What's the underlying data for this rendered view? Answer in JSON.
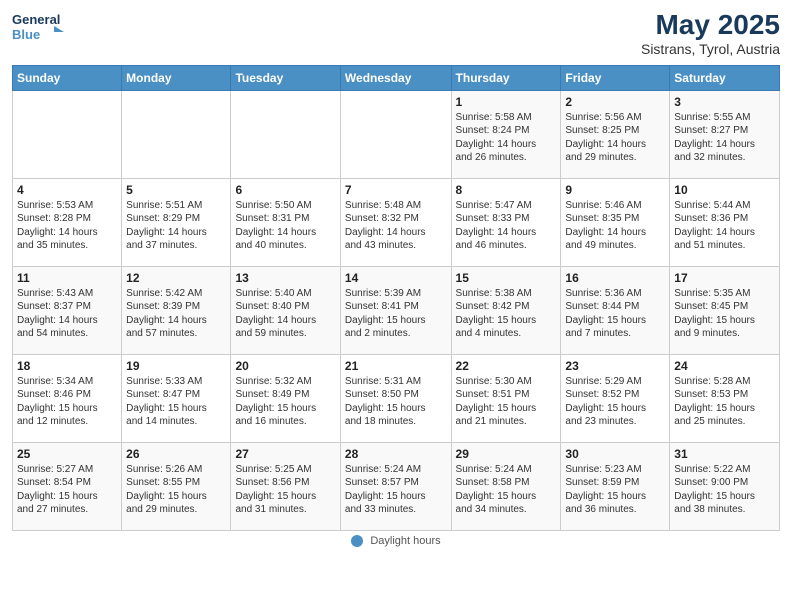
{
  "header": {
    "logo_line1": "General",
    "logo_line2": "Blue",
    "main_title": "May 2025",
    "subtitle": "Sistrans, Tyrol, Austria"
  },
  "footer": {
    "label": "Daylight hours"
  },
  "days_of_week": [
    "Sunday",
    "Monday",
    "Tuesday",
    "Wednesday",
    "Thursday",
    "Friday",
    "Saturday"
  ],
  "weeks": [
    [
      {
        "num": "",
        "info": ""
      },
      {
        "num": "",
        "info": ""
      },
      {
        "num": "",
        "info": ""
      },
      {
        "num": "",
        "info": ""
      },
      {
        "num": "1",
        "info": "Sunrise: 5:58 AM\nSunset: 8:24 PM\nDaylight: 14 hours\nand 26 minutes."
      },
      {
        "num": "2",
        "info": "Sunrise: 5:56 AM\nSunset: 8:25 PM\nDaylight: 14 hours\nand 29 minutes."
      },
      {
        "num": "3",
        "info": "Sunrise: 5:55 AM\nSunset: 8:27 PM\nDaylight: 14 hours\nand 32 minutes."
      }
    ],
    [
      {
        "num": "4",
        "info": "Sunrise: 5:53 AM\nSunset: 8:28 PM\nDaylight: 14 hours\nand 35 minutes."
      },
      {
        "num": "5",
        "info": "Sunrise: 5:51 AM\nSunset: 8:29 PM\nDaylight: 14 hours\nand 37 minutes."
      },
      {
        "num": "6",
        "info": "Sunrise: 5:50 AM\nSunset: 8:31 PM\nDaylight: 14 hours\nand 40 minutes."
      },
      {
        "num": "7",
        "info": "Sunrise: 5:48 AM\nSunset: 8:32 PM\nDaylight: 14 hours\nand 43 minutes."
      },
      {
        "num": "8",
        "info": "Sunrise: 5:47 AM\nSunset: 8:33 PM\nDaylight: 14 hours\nand 46 minutes."
      },
      {
        "num": "9",
        "info": "Sunrise: 5:46 AM\nSunset: 8:35 PM\nDaylight: 14 hours\nand 49 minutes."
      },
      {
        "num": "10",
        "info": "Sunrise: 5:44 AM\nSunset: 8:36 PM\nDaylight: 14 hours\nand 51 minutes."
      }
    ],
    [
      {
        "num": "11",
        "info": "Sunrise: 5:43 AM\nSunset: 8:37 PM\nDaylight: 14 hours\nand 54 minutes."
      },
      {
        "num": "12",
        "info": "Sunrise: 5:42 AM\nSunset: 8:39 PM\nDaylight: 14 hours\nand 57 minutes."
      },
      {
        "num": "13",
        "info": "Sunrise: 5:40 AM\nSunset: 8:40 PM\nDaylight: 14 hours\nand 59 minutes."
      },
      {
        "num": "14",
        "info": "Sunrise: 5:39 AM\nSunset: 8:41 PM\nDaylight: 15 hours\nand 2 minutes."
      },
      {
        "num": "15",
        "info": "Sunrise: 5:38 AM\nSunset: 8:42 PM\nDaylight: 15 hours\nand 4 minutes."
      },
      {
        "num": "16",
        "info": "Sunrise: 5:36 AM\nSunset: 8:44 PM\nDaylight: 15 hours\nand 7 minutes."
      },
      {
        "num": "17",
        "info": "Sunrise: 5:35 AM\nSunset: 8:45 PM\nDaylight: 15 hours\nand 9 minutes."
      }
    ],
    [
      {
        "num": "18",
        "info": "Sunrise: 5:34 AM\nSunset: 8:46 PM\nDaylight: 15 hours\nand 12 minutes."
      },
      {
        "num": "19",
        "info": "Sunrise: 5:33 AM\nSunset: 8:47 PM\nDaylight: 15 hours\nand 14 minutes."
      },
      {
        "num": "20",
        "info": "Sunrise: 5:32 AM\nSunset: 8:49 PM\nDaylight: 15 hours\nand 16 minutes."
      },
      {
        "num": "21",
        "info": "Sunrise: 5:31 AM\nSunset: 8:50 PM\nDaylight: 15 hours\nand 18 minutes."
      },
      {
        "num": "22",
        "info": "Sunrise: 5:30 AM\nSunset: 8:51 PM\nDaylight: 15 hours\nand 21 minutes."
      },
      {
        "num": "23",
        "info": "Sunrise: 5:29 AM\nSunset: 8:52 PM\nDaylight: 15 hours\nand 23 minutes."
      },
      {
        "num": "24",
        "info": "Sunrise: 5:28 AM\nSunset: 8:53 PM\nDaylight: 15 hours\nand 25 minutes."
      }
    ],
    [
      {
        "num": "25",
        "info": "Sunrise: 5:27 AM\nSunset: 8:54 PM\nDaylight: 15 hours\nand 27 minutes."
      },
      {
        "num": "26",
        "info": "Sunrise: 5:26 AM\nSunset: 8:55 PM\nDaylight: 15 hours\nand 29 minutes."
      },
      {
        "num": "27",
        "info": "Sunrise: 5:25 AM\nSunset: 8:56 PM\nDaylight: 15 hours\nand 31 minutes."
      },
      {
        "num": "28",
        "info": "Sunrise: 5:24 AM\nSunset: 8:57 PM\nDaylight: 15 hours\nand 33 minutes."
      },
      {
        "num": "29",
        "info": "Sunrise: 5:24 AM\nSunset: 8:58 PM\nDaylight: 15 hours\nand 34 minutes."
      },
      {
        "num": "30",
        "info": "Sunrise: 5:23 AM\nSunset: 8:59 PM\nDaylight: 15 hours\nand 36 minutes."
      },
      {
        "num": "31",
        "info": "Sunrise: 5:22 AM\nSunset: 9:00 PM\nDaylight: 15 hours\nand 38 minutes."
      }
    ]
  ]
}
